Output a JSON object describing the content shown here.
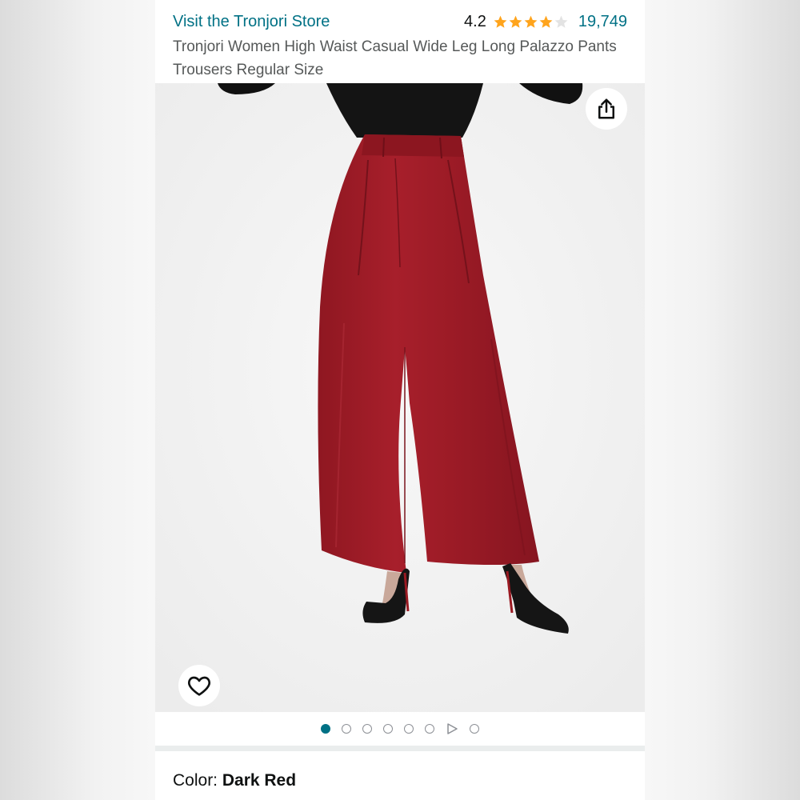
{
  "header": {
    "store_link": "Visit the Tronjori Store",
    "rating_value": "4.2",
    "stars_filled": 4.2,
    "stars_max": 5,
    "review_count": "19,749",
    "title": "Tronjori Women High Waist Casual Wide Leg Long Palazzo Pants Trousers Regular Size"
  },
  "gallery": {
    "dot_count": 8,
    "active_index": 0,
    "video_index": 6
  },
  "color": {
    "label": "Color:",
    "value": "Dark Red"
  },
  "colors": {
    "link": "#007185",
    "star": "#ffa41c",
    "product": "#9e1b26"
  }
}
